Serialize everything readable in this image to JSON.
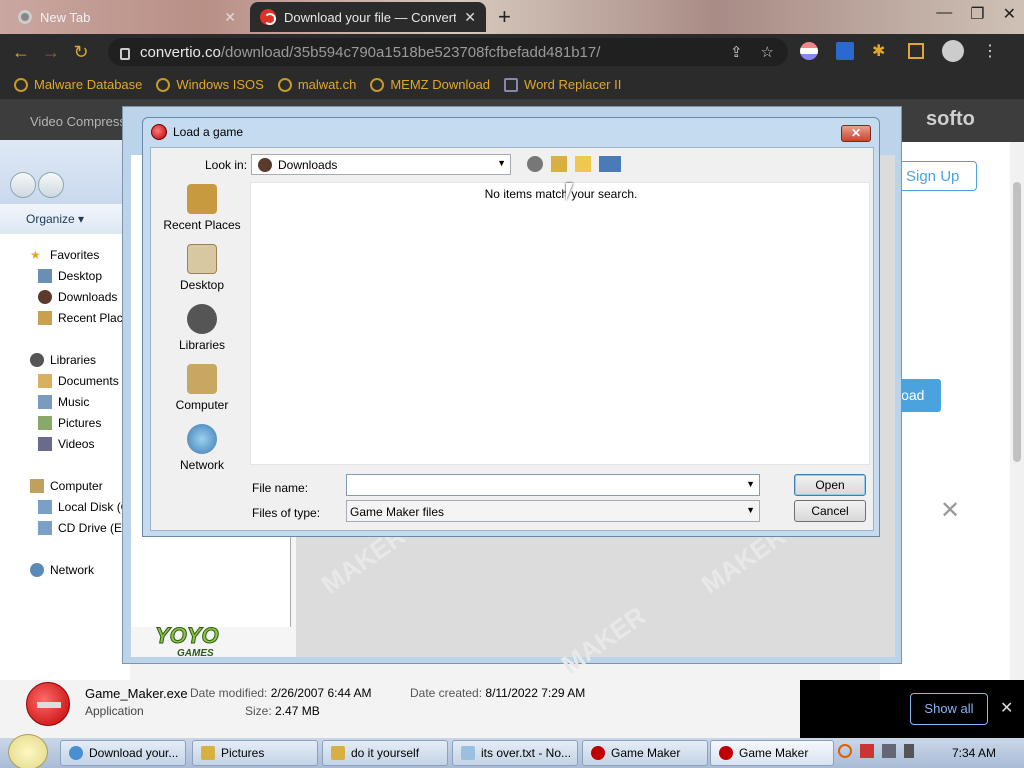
{
  "browser": {
    "tabs": [
      {
        "title": "New Tab",
        "close": "✕"
      },
      {
        "title": "Download your file — Convertio",
        "close": "✕"
      }
    ],
    "new_tab": "+",
    "url_host": "convertio.co",
    "url_path": "/download/35b594c790a1518be523708fcfbefadd481b17/",
    "bookmarks": [
      "Malware Database",
      "Windows ISOS",
      "malwat.ch",
      "MEMZ Download",
      "Word Replacer II"
    ]
  },
  "website": {
    "nav_text": "Video Compressor",
    "logo": "softo",
    "signup": "Sign Up",
    "download_btn": "load",
    "close": "✕"
  },
  "explorer": {
    "organize": "Organize ▾",
    "favorites": [
      "Favorites",
      "Desktop",
      "Downloads",
      "Recent Places"
    ],
    "libraries": [
      "Libraries",
      "Documents",
      "Music",
      "Pictures",
      "Videos"
    ],
    "computer": [
      "Computer",
      "Local Disk (C:)",
      "CD Drive (E:)"
    ],
    "network": "Network"
  },
  "gm_window": {
    "brand": "YOYO",
    "brand_sub": "GAMES",
    "watermark": "MAKER"
  },
  "dialog": {
    "title": "Load a game",
    "close": "✕",
    "look_in_label": "Look in:",
    "look_in_value": "Downloads",
    "places": [
      "Recent Places",
      "Desktop",
      "Libraries",
      "Computer",
      "Network"
    ],
    "empty_message": "No items match your search.",
    "file_name_label": "File name:",
    "file_name_value": "",
    "files_of_type_label": "Files of type:",
    "files_of_type_value": "Game Maker files",
    "open": "Open",
    "cancel": "Cancel"
  },
  "download_bar": {
    "file_name": "Game_Maker.exe",
    "file_type": "Application",
    "date_modified_label": "Date modified:",
    "date_modified": "2/26/2007 6:44 AM",
    "date_created_label": "Date created:",
    "date_created": "8/11/2022 7:29 AM",
    "size_label": "Size:",
    "size": "2.47 MB",
    "show_all": "Show all",
    "close": "✕"
  },
  "taskbar": {
    "items": [
      "Download your...",
      "Pictures",
      "do it yourself",
      "its over.txt - No...",
      "Game Maker",
      "Game Maker"
    ],
    "clock": "7:34 AM"
  },
  "colors": {
    "chrome_accent": "#e0a72a",
    "link_blue": "#4aa3df",
    "gm_red": "#c00000"
  }
}
